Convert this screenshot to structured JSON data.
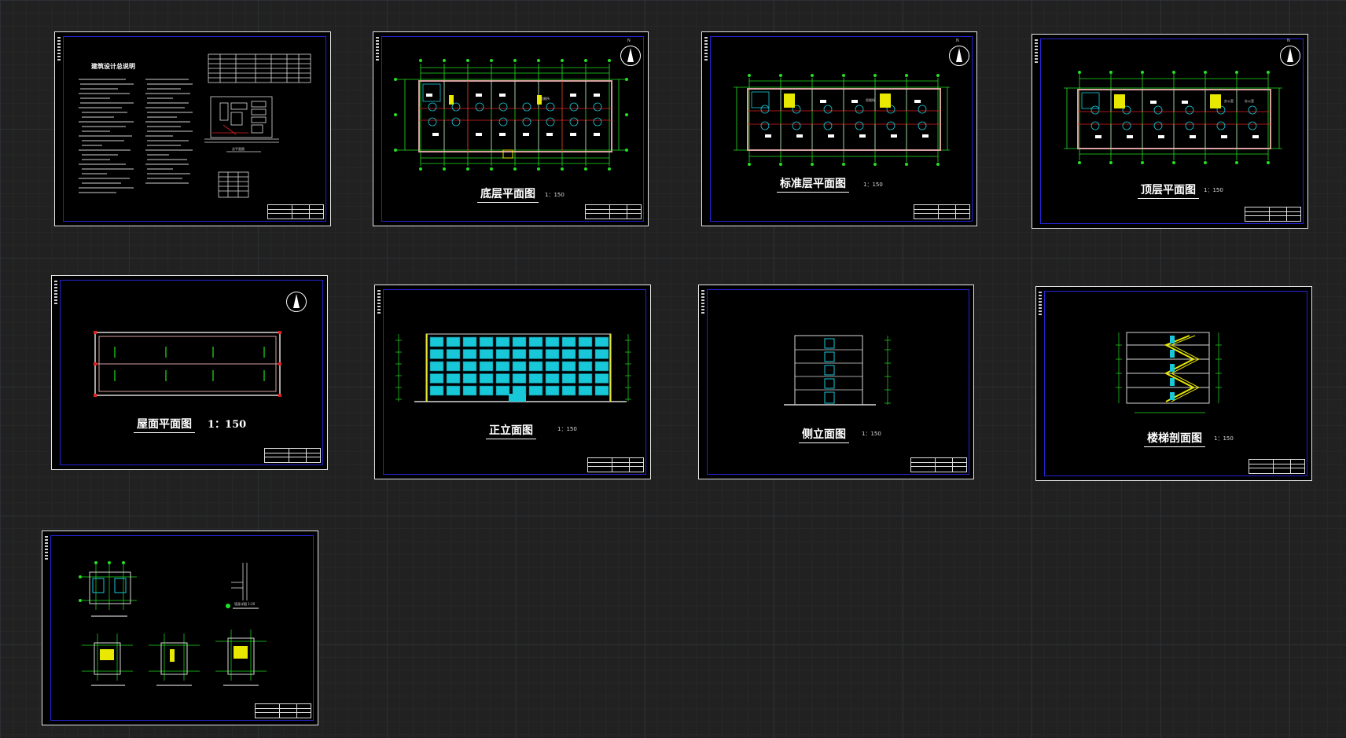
{
  "sheets": {
    "notes": {
      "heading": "建筑设计总说明",
      "site_label": "总平面图"
    },
    "ground_floor": {
      "title": "底层平面图",
      "scale": "1：150",
      "room_label": "男厕所",
      "north": "N"
    },
    "standard_floor": {
      "title": "标准层平面图",
      "scale": "1：150",
      "room_label": "男厕所",
      "north": "N"
    },
    "top_floor": {
      "title": "顶层平面图",
      "scale": "1：150",
      "room_label_a": "办公室",
      "room_label_b": "办公室",
      "north": "N"
    },
    "roof": {
      "title": "屋面平面图",
      "scale": "1：150"
    },
    "front_elevation": {
      "title": "正立面图",
      "scale": "1：150"
    },
    "side_elevation": {
      "title": "侧立面图",
      "scale": "1：150"
    },
    "stair_section": {
      "title": "楼梯剖面图",
      "scale": "1：150"
    },
    "details": {
      "callout": "墙身详图 1:20"
    }
  },
  "colors": {
    "background": "#212121",
    "sheet_border": "#e6e6e6",
    "inner_frame": "#2424d6",
    "axis_green": "#22e022",
    "axis_red": "#e02020",
    "window_cyan": "#19c8d8",
    "stair_yellow": "#e8e800"
  }
}
